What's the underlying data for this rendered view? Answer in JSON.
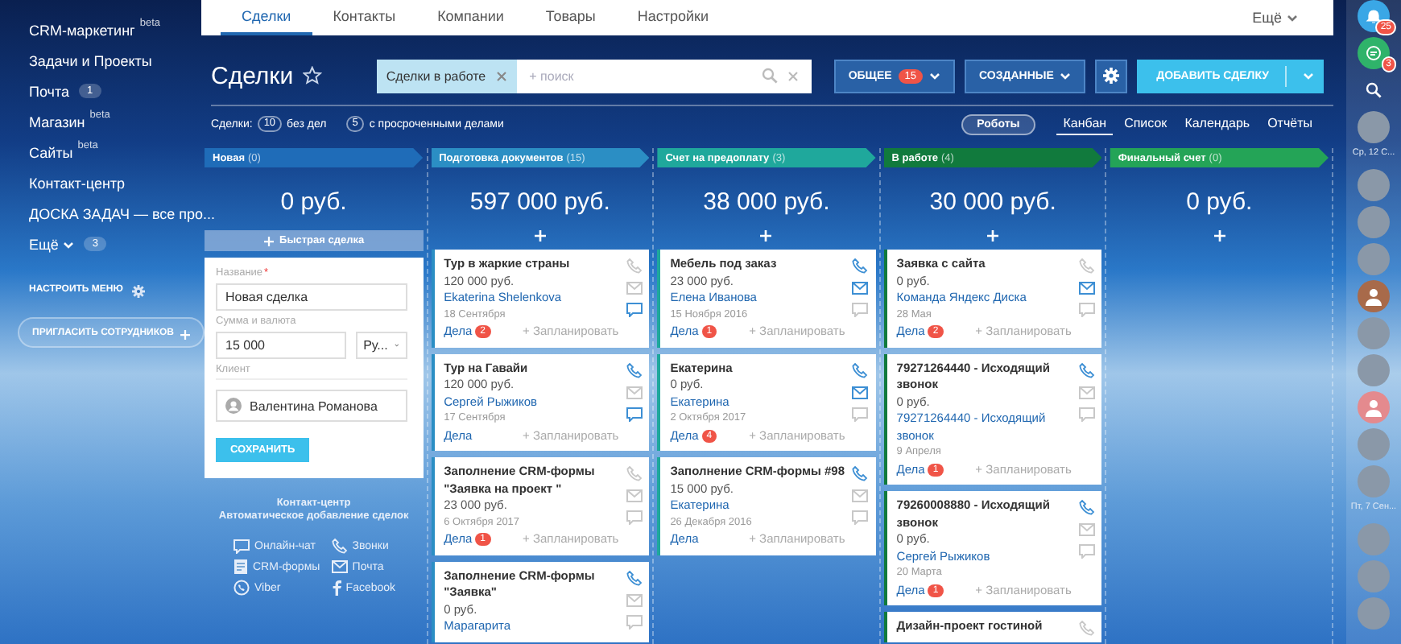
{
  "sidebar": {
    "items": [
      {
        "label": "CRM-маркетинг",
        "sup": "beta"
      },
      {
        "label": "Задачи и Проекты"
      },
      {
        "label": "Почта",
        "counter": "1"
      },
      {
        "label": "Магазин",
        "sup": "beta"
      },
      {
        "label": "Сайты",
        "sup": "beta"
      },
      {
        "label": "Контакт-центр"
      },
      {
        "label": "ДОСКА ЗАДАЧ — все про..."
      },
      {
        "label": "Ещё",
        "dropdown": true,
        "counter": "3"
      }
    ],
    "configure": "НАСТРОИТЬ МЕНЮ",
    "invite": "ПРИГЛАСИТЬ СОТРУДНИКОВ"
  },
  "tabs": [
    {
      "label": "Сделки",
      "selected": true
    },
    {
      "label": "Контакты",
      "selected": false
    },
    {
      "label": "Компании",
      "selected": false
    },
    {
      "label": "Товары",
      "selected": false
    },
    {
      "label": "Настройки",
      "selected": false
    }
  ],
  "tabs_more": "Ещё",
  "toolbar": {
    "title": "Сделки",
    "filter_tag": "Сделки в работе",
    "search": {
      "placeholder": "+ поиск"
    },
    "general": "ОБЩЕЕ",
    "general_count": "15",
    "created": "СОЗДАННЫЕ",
    "add": "ДОБАВИТЬ СДЕЛКУ"
  },
  "summary": {
    "label": "Сделки:",
    "no_tasks_count": "10",
    "no_tasks": "без дел",
    "overdue_count": "5",
    "overdue": "с просроченными делами"
  },
  "robots": "Роботы",
  "views": [
    {
      "label": "Канбан",
      "selected": true
    },
    {
      "label": "Список",
      "selected": false
    },
    {
      "label": "Календарь",
      "selected": false
    },
    {
      "label": "Отчёты",
      "selected": false
    }
  ],
  "columns": [
    {
      "name": "Новая",
      "count": "(0)",
      "color": "#1f6cb8",
      "sum": "0 руб.",
      "quick_deal": {
        "button": "Быстрая сделка",
        "name_label": "Название",
        "required_mark": "*",
        "name_value": "Новая сделка",
        "sum_label": "Сумма и валюта",
        "sum_value": "15 000",
        "currency": "Ру...",
        "client_label": "Клиент",
        "client_value": "Валентина Романова",
        "save": "СОХРАНИТЬ"
      },
      "contact_center": {
        "title": "Контакт-центр",
        "subtitle": "Автоматическое добавление сделок",
        "channels": [
          {
            "kind": "chat",
            "label": "Онлайн-чат"
          },
          {
            "kind": "phone",
            "label": "Звонки"
          },
          {
            "kind": "form",
            "label": "CRM-формы"
          },
          {
            "kind": "mail",
            "label": "Почта"
          },
          {
            "kind": "viber",
            "label": "Viber"
          },
          {
            "kind": "facebook",
            "label": "Facebook"
          }
        ]
      }
    },
    {
      "name": "Подготовка документов",
      "count": "(15)",
      "color": "#2b8ec4",
      "sum": "597 000 руб.",
      "cards": [
        {
          "title": "Тур в жаркие страны",
          "sum": "120 000 руб.",
          "contact": "Ekaterina Shelenkova",
          "date": "18 Сентября",
          "tasks": "Дела",
          "tasks_count": "2",
          "plan": "+ Запланировать",
          "phone": false,
          "mail": false,
          "chat": true
        },
        {
          "title": "Тур на Гавайи",
          "sum": "120 000 руб.",
          "contact": "Сергей Рыжиков",
          "date": "17 Сентября",
          "tasks": "Дела",
          "plan": "+ Запланировать",
          "phone": true,
          "mail": false,
          "chat": true
        },
        {
          "title": "Заполнение CRM-формы \"Заявка на проект \"",
          "sum": "23 000 руб.",
          "date": "6 Октября 2017",
          "tasks": "Дела",
          "tasks_count": "1",
          "plan": "+ Запланировать",
          "phone": false,
          "mail": false,
          "chat": false
        },
        {
          "title": "Заполнение CRM-формы \"Заявка\"",
          "sum": "0 руб.",
          "contact": "Марагарита",
          "phone": true,
          "mail": false,
          "chat": false
        }
      ]
    },
    {
      "name": "Счет на предоплату",
      "count": "(3)",
      "color": "#1fa89c",
      "sum": "38 000 руб.",
      "cards": [
        {
          "title": "Мебель под заказ",
          "sum": "23 000 руб.",
          "contact": "Елена Иванова",
          "date": "15 Ноября 2016",
          "tasks": "Дела",
          "tasks_count": "1",
          "plan": "+ Запланировать",
          "phone": true,
          "mail": true,
          "chat": false
        },
        {
          "title": "Екатерина",
          "sum": "0 руб.",
          "contact": "Екатерина",
          "date": "2 Октября 2017",
          "tasks": "Дела",
          "tasks_count": "4",
          "plan": "+ Запланировать",
          "phone": true,
          "mail": true,
          "chat": false
        },
        {
          "title": "Заполнение CRM-формы #98",
          "sum": "15 000 руб.",
          "contact": "Екатерина",
          "date": "26 Декабря 2016",
          "tasks": "Дела",
          "plan": "+ Запланировать",
          "phone": true,
          "mail": false,
          "chat": false
        }
      ]
    },
    {
      "name": "В работе",
      "count": "(4)",
      "color": "#117a3d",
      "sum": "30 000 руб.",
      "cards": [
        {
          "title": "Заявка с сайта",
          "sum": "0 руб.",
          "contact": "Команда Яндекс Диска",
          "date": "28 Мая",
          "tasks": "Дела",
          "tasks_count": "2",
          "plan": "+ Запланировать",
          "phone": false,
          "mail": true,
          "chat": false
        },
        {
          "title": "79271264440 - Исходящий звонок",
          "sum": "0 руб.",
          "contact": "79271264440 - Исходящий звонок",
          "date": "9 Апреля",
          "tasks": "Дела",
          "tasks_count": "1",
          "plan": "+ Запланировать",
          "phone": true,
          "mail": false,
          "chat": false
        },
        {
          "title": "79260008880 - Исходящий звонок",
          "sum": "0 руб.",
          "contact": "Сергей Рыжиков",
          "date": "20 Марта",
          "tasks": "Дела",
          "tasks_count": "1",
          "plan": "+ Запланировать",
          "phone": true,
          "mail": false,
          "chat": false
        },
        {
          "title": "Дизайн-проект гостиной",
          "phone": false
        }
      ]
    },
    {
      "name": "Финальный счет",
      "count": "(0)",
      "color": "#24a457",
      "sum": "0 руб."
    }
  ],
  "rail": [
    {
      "kind": "bell",
      "counter": "25"
    },
    {
      "kind": "chats",
      "counter": "3"
    },
    {
      "kind": "search"
    },
    {
      "kind": "avatar"
    },
    {
      "kind": "date",
      "label": "Ср, 12 С..."
    },
    {
      "kind": "avatar"
    },
    {
      "kind": "avatar"
    },
    {
      "kind": "avatar"
    },
    {
      "kind": "user",
      "color": "#a86a4a"
    },
    {
      "kind": "avatar"
    },
    {
      "kind": "avatar"
    },
    {
      "kind": "user",
      "color": "#e48a8e"
    },
    {
      "kind": "avatar"
    },
    {
      "kind": "avatar"
    },
    {
      "kind": "date",
      "label": "Пт, 7 Сен..."
    },
    {
      "kind": "avatar"
    },
    {
      "kind": "avatar"
    },
    {
      "kind": "avatar"
    }
  ]
}
